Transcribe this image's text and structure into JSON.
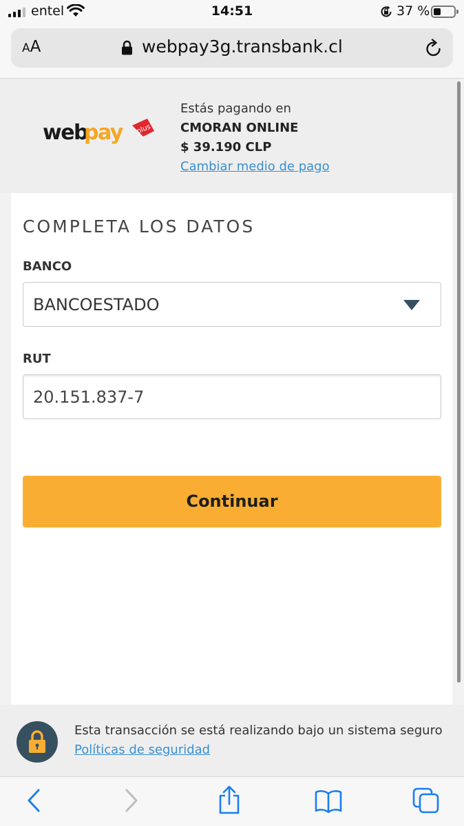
{
  "status_bar": {
    "carrier": "entel",
    "time": "14:51",
    "battery_percent": "37 %",
    "battery_level": 0.37,
    "icons": [
      "signal-icon",
      "wifi-icon",
      "orientation-lock-icon",
      "battery-icon"
    ]
  },
  "browser": {
    "text_size_label": "AA",
    "url": "webpay3g.transbank.cl",
    "icons": [
      "padlock-icon",
      "reload-icon"
    ]
  },
  "header": {
    "logo_alt": "webpay plus",
    "paying_at_label": "Estás pagando en",
    "merchant_name": "CMORAN ONLINE",
    "amount": "$ 39.190 CLP",
    "change_payment_link": "Cambiar medio de pago"
  },
  "form": {
    "title": "COMPLETA LOS DATOS",
    "bank_label": "BANCO",
    "bank_value": "BANCOESTADO",
    "rut_label": "RUT",
    "rut_value": "20.151.837-7",
    "continue_label": "Continuar"
  },
  "security": {
    "message": "Esta transacción se está realizando bajo un sistema seguro",
    "policy_link": "Políticas de seguridad"
  },
  "toolbar": {
    "icons": [
      "back-icon",
      "forward-icon",
      "share-icon",
      "bookmarks-icon",
      "tabs-icon"
    ]
  },
  "colors": {
    "accent": "#f9ae33",
    "link": "#3a8fd0",
    "badge": "#37505f",
    "ios_blue": "#1a7ef0"
  }
}
